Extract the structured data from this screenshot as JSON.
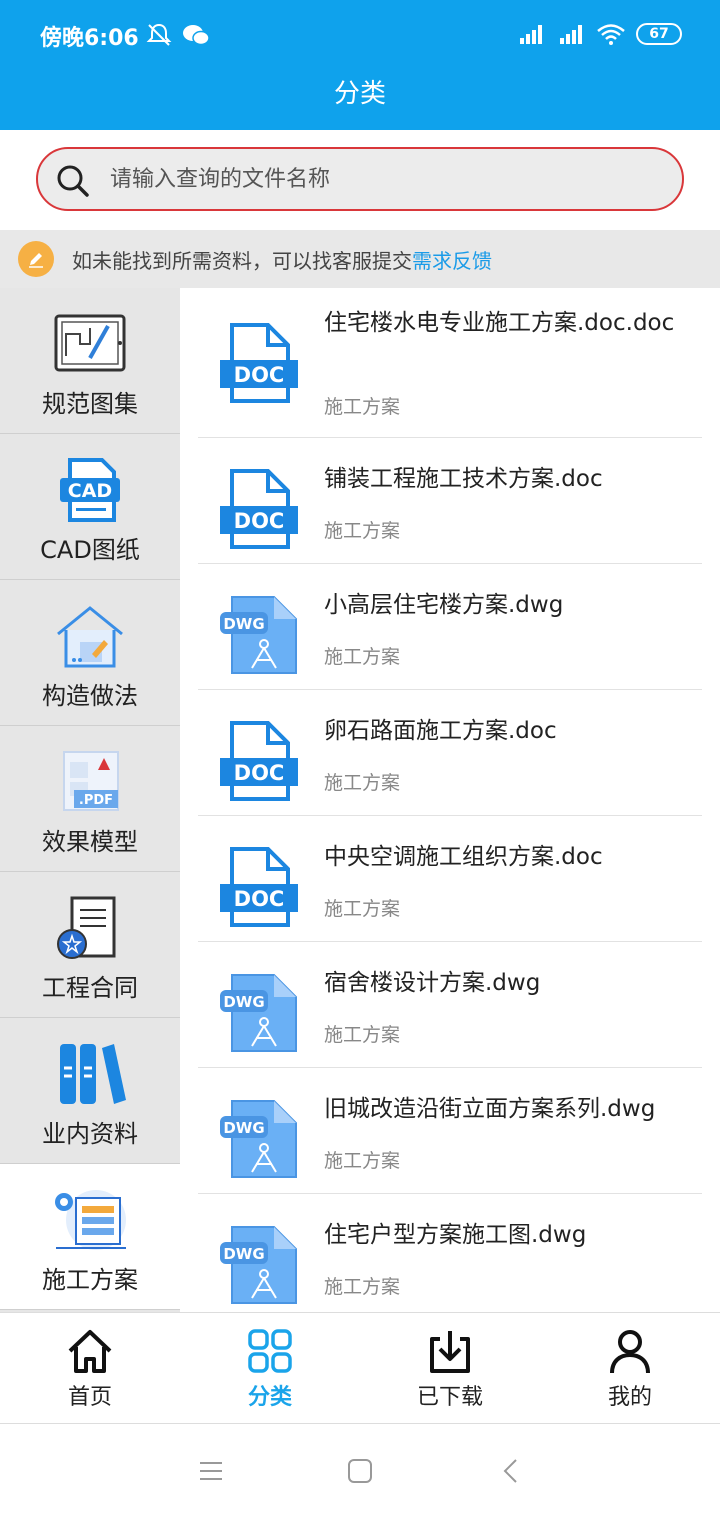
{
  "status_bar": {
    "time": "傍晚6:06",
    "battery": "67"
  },
  "header": {
    "title": "分类"
  },
  "search": {
    "placeholder": "请输入查询的文件名称"
  },
  "notice": {
    "text": "如未能找到所需资料，可以找客服提交",
    "link": "需求反馈"
  },
  "sidebar": {
    "items": [
      {
        "label": "规范图集"
      },
      {
        "label": "CAD图纸"
      },
      {
        "label": "构造做法"
      },
      {
        "label": "效果模型"
      },
      {
        "label": "工程合同"
      },
      {
        "label": "业内资料"
      },
      {
        "label": "施工方案"
      }
    ],
    "active_index": 6
  },
  "files": [
    {
      "name": "住宅楼水电专业施工方案.doc.doc",
      "category": "施工方案",
      "type": "DOC"
    },
    {
      "name": "铺装工程施工技术方案.doc",
      "category": "施工方案",
      "type": "DOC"
    },
    {
      "name": "小高层住宅楼方案.dwg",
      "category": "施工方案",
      "type": "DWG"
    },
    {
      "name": "卵石路面施工方案.doc",
      "category": "施工方案",
      "type": "DOC"
    },
    {
      "name": "中央空调施工组织方案.doc",
      "category": "施工方案",
      "type": "DOC"
    },
    {
      "name": "宿舍楼设计方案.dwg",
      "category": "施工方案",
      "type": "DWG"
    },
    {
      "name": "旧城改造沿街立面方案系列.dwg",
      "category": "施工方案",
      "type": "DWG"
    },
    {
      "name": "住宅户型方案施工图.dwg",
      "category": "施工方案",
      "type": "DWG"
    }
  ],
  "bottom_nav": {
    "items": [
      {
        "label": "首页"
      },
      {
        "label": "分类"
      },
      {
        "label": "已下载"
      },
      {
        "label": "我的"
      }
    ],
    "active_index": 1
  },
  "colors": {
    "brand": "#0fa2ec",
    "search_border": "#d9373a",
    "active_nav": "#1aa4ea",
    "doc_blue": "#1c86e0",
    "dwg_blue": "#6ab0f5"
  }
}
